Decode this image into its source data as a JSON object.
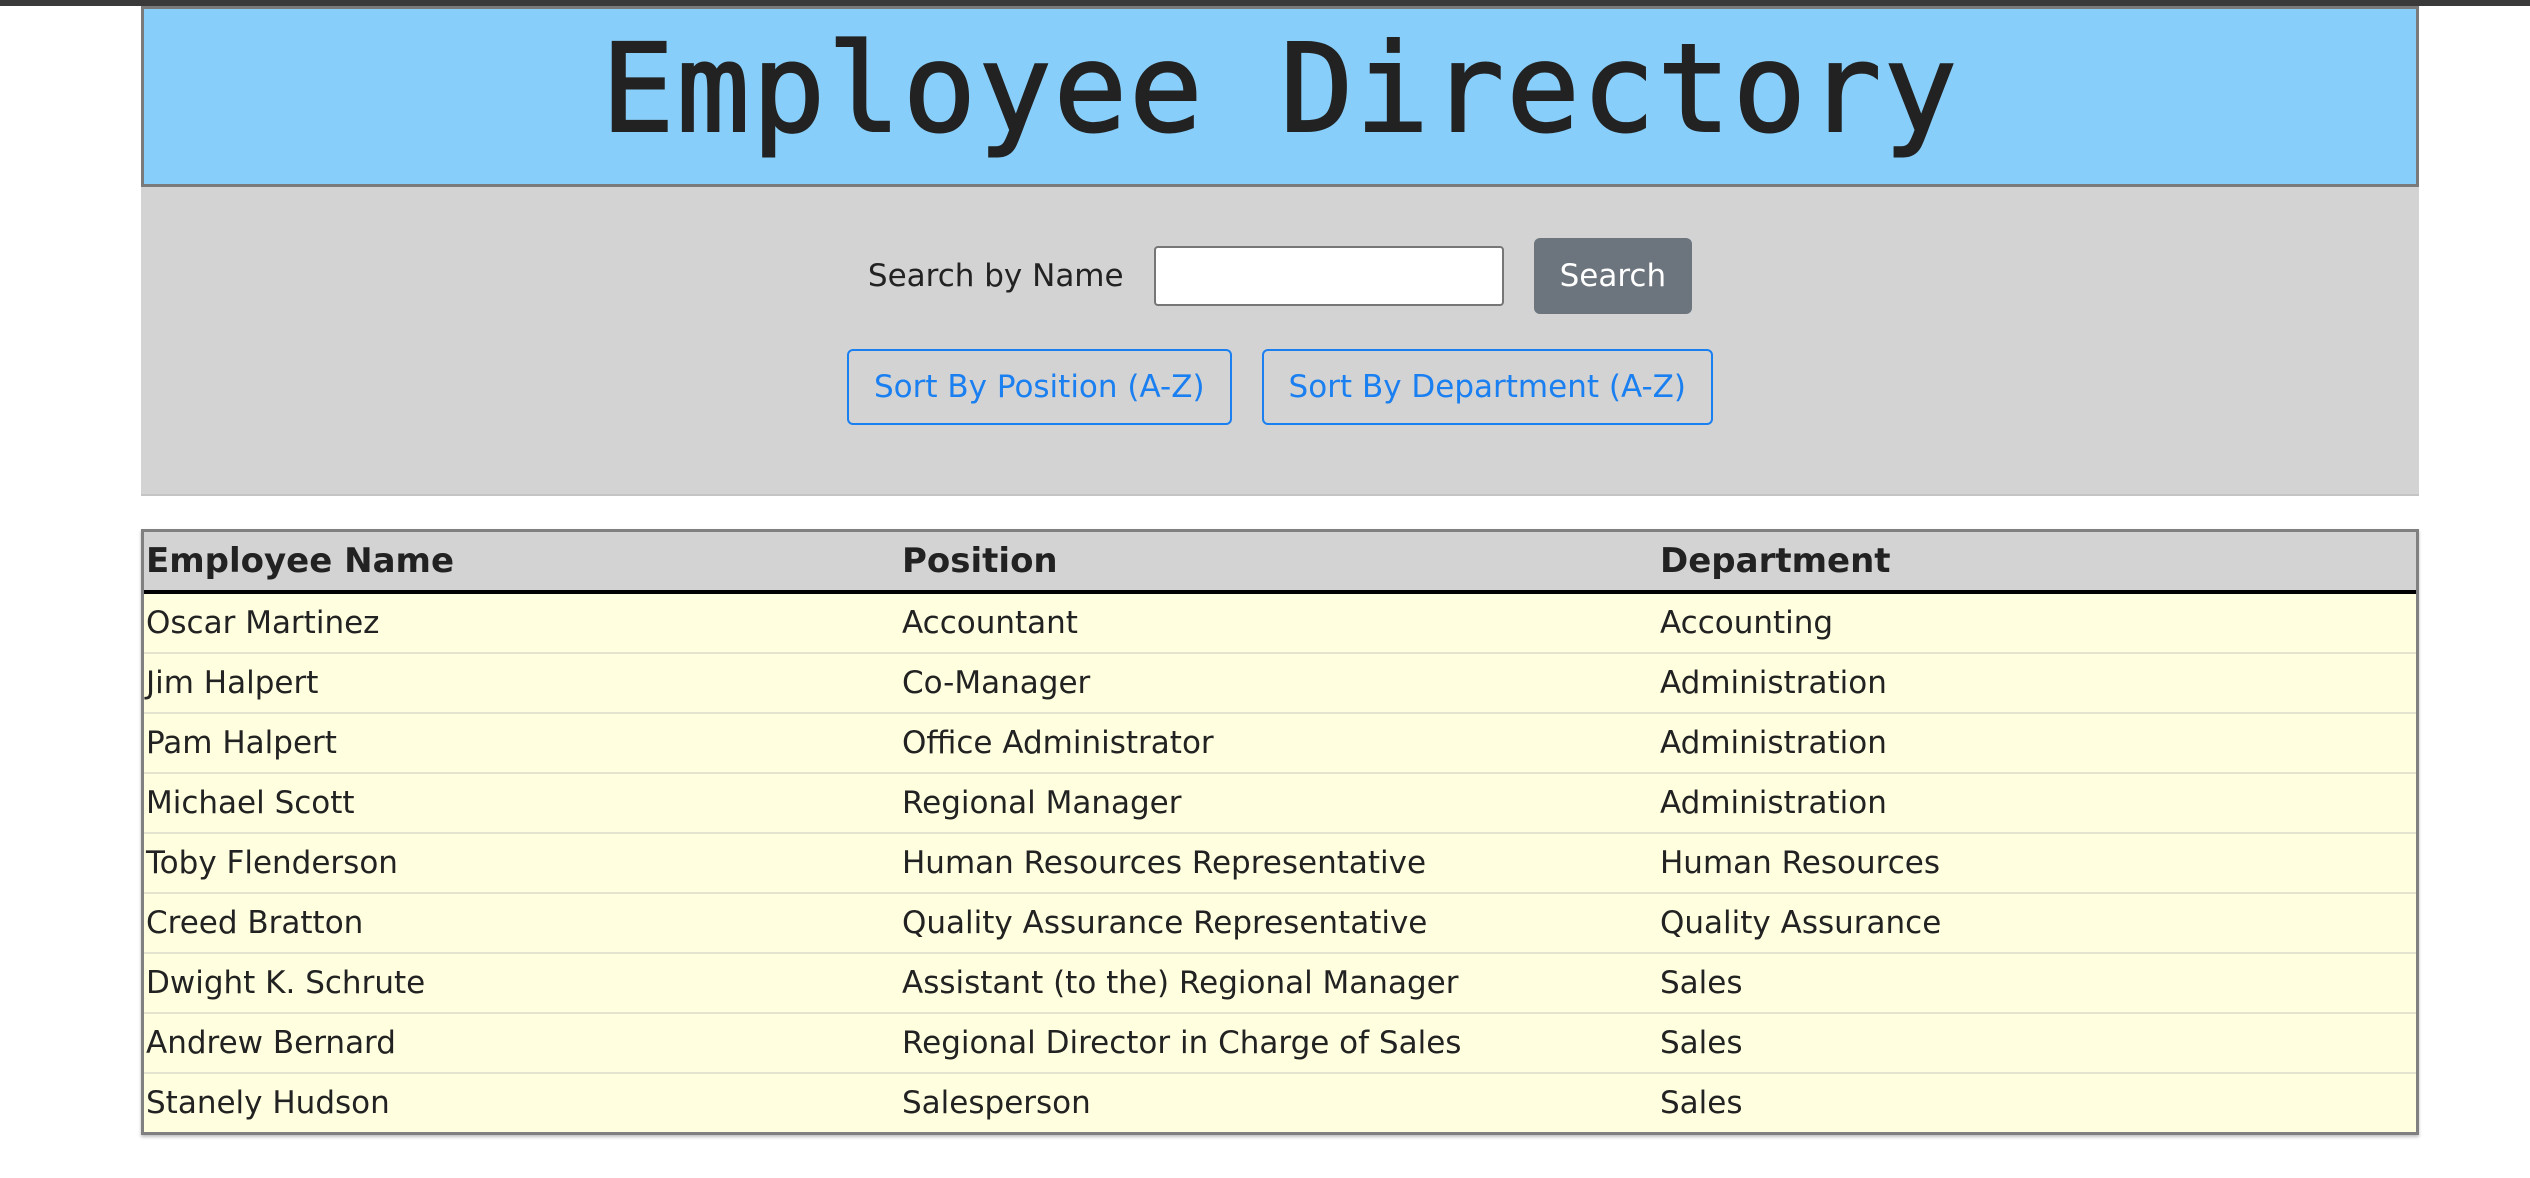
{
  "header": {
    "title": "Employee Directory"
  },
  "search": {
    "label": "Search by Name",
    "value": "",
    "placeholder": "",
    "button_label": "Search"
  },
  "sort": {
    "position_label": "Sort By Position (A-Z)",
    "department_label": "Sort By Department (A-Z)"
  },
  "table": {
    "columns": [
      "Employee Name",
      "Position",
      "Department"
    ],
    "rows": [
      [
        "Oscar Martinez",
        "Accountant",
        "Accounting"
      ],
      [
        "Jim Halpert",
        "Co-Manager",
        "Administration"
      ],
      [
        "Pam Halpert",
        "Office Administrator",
        "Administration"
      ],
      [
        "Michael Scott",
        "Regional Manager",
        "Administration"
      ],
      [
        "Toby Flenderson",
        "Human Resources Representative",
        "Human Resources"
      ],
      [
        "Creed Bratton",
        "Quality Assurance Representative",
        "Quality Assurance"
      ],
      [
        "Dwight K. Schrute",
        "Assistant (to the) Regional Manager",
        "Sales"
      ],
      [
        "Andrew Bernard",
        "Regional Director in Charge of Sales",
        "Sales"
      ],
      [
        "Stanely Hudson",
        "Salesperson",
        "Sales"
      ]
    ]
  },
  "colors": {
    "header_bg": "#87cefa",
    "controls_bg": "#d3d3d3",
    "row_bg": "#ffffe0",
    "search_button_bg": "#6c757d",
    "sort_button_accent": "#1a7ff0"
  }
}
